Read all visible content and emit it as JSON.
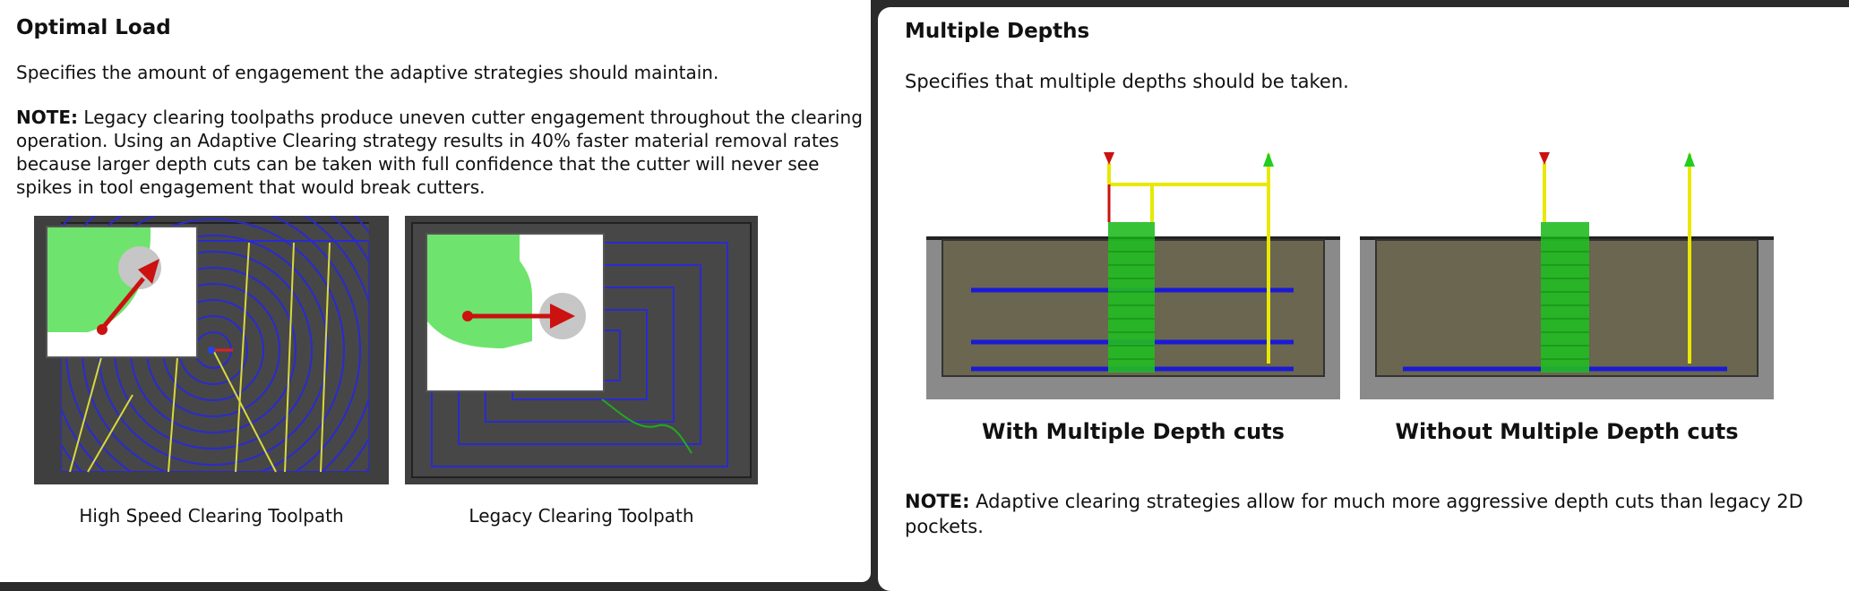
{
  "left": {
    "title": "Optimal Load",
    "description": "Specifies the amount of engagement the adaptive strategies should maintain.",
    "note_label": "NOTE:",
    "note_text": " Legacy clearing toolpaths produce uneven cutter engagement throughout the clearing operation. Using an Adaptive Clearing strategy results in 40% faster material removal rates because larger depth cuts can be taken with full confidence that the cutter will never see spikes in tool engagement that would break cutters.",
    "images": [
      {
        "caption": "High Speed Clearing Toolpath"
      },
      {
        "caption": "Legacy Clearing Toolpath"
      }
    ]
  },
  "right": {
    "title": "Multiple Depths",
    "description": "Specifies that multiple depths should be taken.",
    "images": [
      {
        "caption": "With Multiple Depth cuts"
      },
      {
        "caption": "Without Multiple Depth cuts"
      }
    ],
    "note_label": "NOTE:",
    "note_text": " Adaptive clearing strategies allow for much more aggressive depth cuts than legacy 2D pockets."
  },
  "colors": {
    "toolpath_blue": "#1a1ad6",
    "toolpath_yellow": "#e8e800",
    "engage_green": "#22bb22",
    "stock_olive": "#6b6650",
    "arrow_red": "#cc1111",
    "material_green": "#66dd66"
  }
}
